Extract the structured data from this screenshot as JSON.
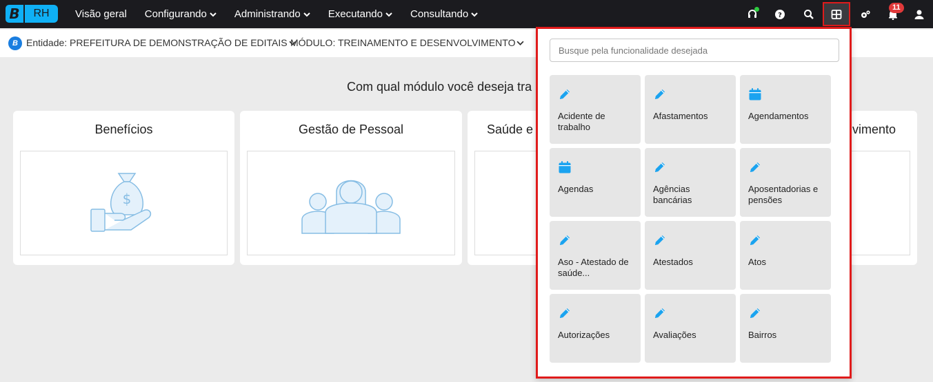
{
  "app": {
    "logo_letter": "B",
    "logo_name": "RH"
  },
  "nav": [
    "Visão geral",
    "Configurando",
    "Administrando",
    "Executando",
    "Consultando"
  ],
  "notifications": {
    "count": "11"
  },
  "entity": {
    "label": "Entidade: PREFEITURA DE DEMONSTRAÇÃO DE EDITAIS",
    "module": "MÓDULO: TREINAMENTO E DESENVOLVIMENTO",
    "logo_letter": "B"
  },
  "main": {
    "question": "Com qual módulo você deseja tra",
    "cards": [
      "Benefícios",
      "Gestão de Pessoal",
      "Saúde e S",
      "vimento"
    ]
  },
  "panel": {
    "search_placeholder": "Busque pela funcionalidade desejada",
    "tiles": [
      {
        "label": "Acidente de trabalho",
        "icon": "pencil-icon"
      },
      {
        "label": "Afastamentos",
        "icon": "pencil-icon"
      },
      {
        "label": "Agendamentos",
        "icon": "calendar-icon"
      },
      {
        "label": "Agendas",
        "icon": "calendar-icon"
      },
      {
        "label": "Agências bancárias",
        "icon": "pencil-icon"
      },
      {
        "label": "Aposentadorias e pensões",
        "icon": "pencil-icon"
      },
      {
        "label": "Aso - Atestado de saúde...",
        "icon": "pencil-icon"
      },
      {
        "label": "Atestados",
        "icon": "pencil-icon"
      },
      {
        "label": "Atos",
        "icon": "pencil-icon"
      },
      {
        "label": "Autorizações",
        "icon": "pencil-icon"
      },
      {
        "label": "Avaliações",
        "icon": "pencil-icon"
      },
      {
        "label": "Bairros",
        "icon": "pencil-icon"
      }
    ]
  },
  "colors": {
    "accent": "#0fb0f5",
    "topbar": "#1b1b1f",
    "highlight": "#e01b1b",
    "icon_blue": "#1aa3f0"
  }
}
